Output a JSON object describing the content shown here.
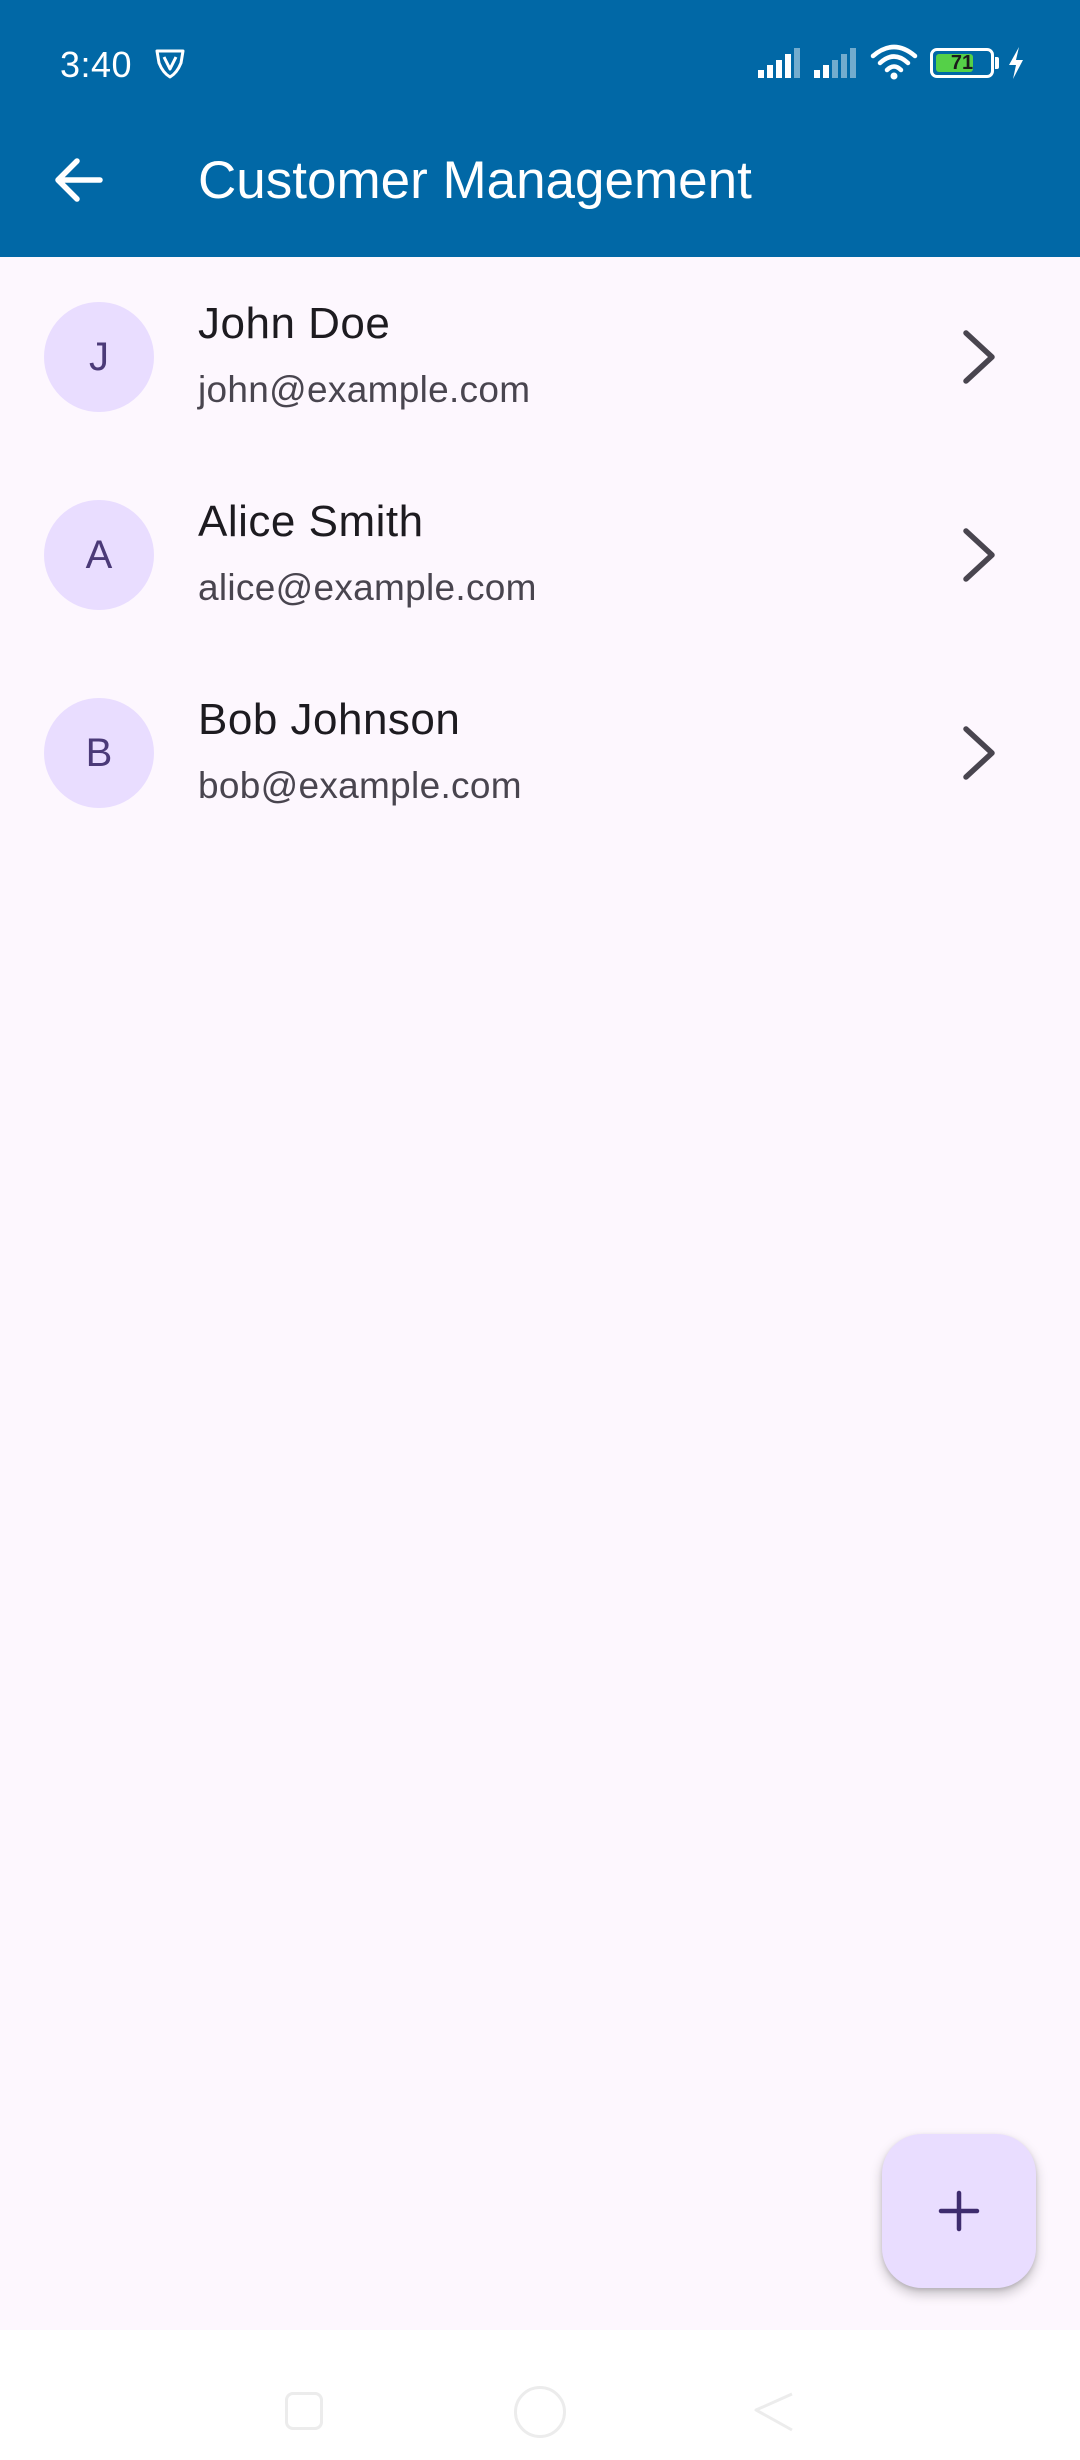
{
  "status_bar": {
    "time": "3:40",
    "battery_level": "71",
    "battery_fraction": 0.71
  },
  "app_bar": {
    "title": "Customer Management",
    "back_icon": "arrow-back-icon"
  },
  "customers": [
    {
      "initial": "J",
      "name": "John Doe",
      "email": "john@example.com"
    },
    {
      "initial": "A",
      "name": "Alice Smith",
      "email": "alice@example.com"
    },
    {
      "initial": "B",
      "name": "Bob Johnson",
      "email": "bob@example.com"
    }
  ],
  "fab": {
    "icon": "add-icon"
  },
  "navigation_bar": {
    "icons": [
      "recent-apps-icon",
      "home-icon",
      "back-icon"
    ]
  },
  "colors": {
    "app_bar": "#0168A6",
    "background": "#FDF7FE",
    "avatar_bg": "#E9DDFF",
    "avatar_text": "#4B3A78",
    "fab_bg": "#E9DDFF",
    "battery_fill": "#55D048"
  }
}
